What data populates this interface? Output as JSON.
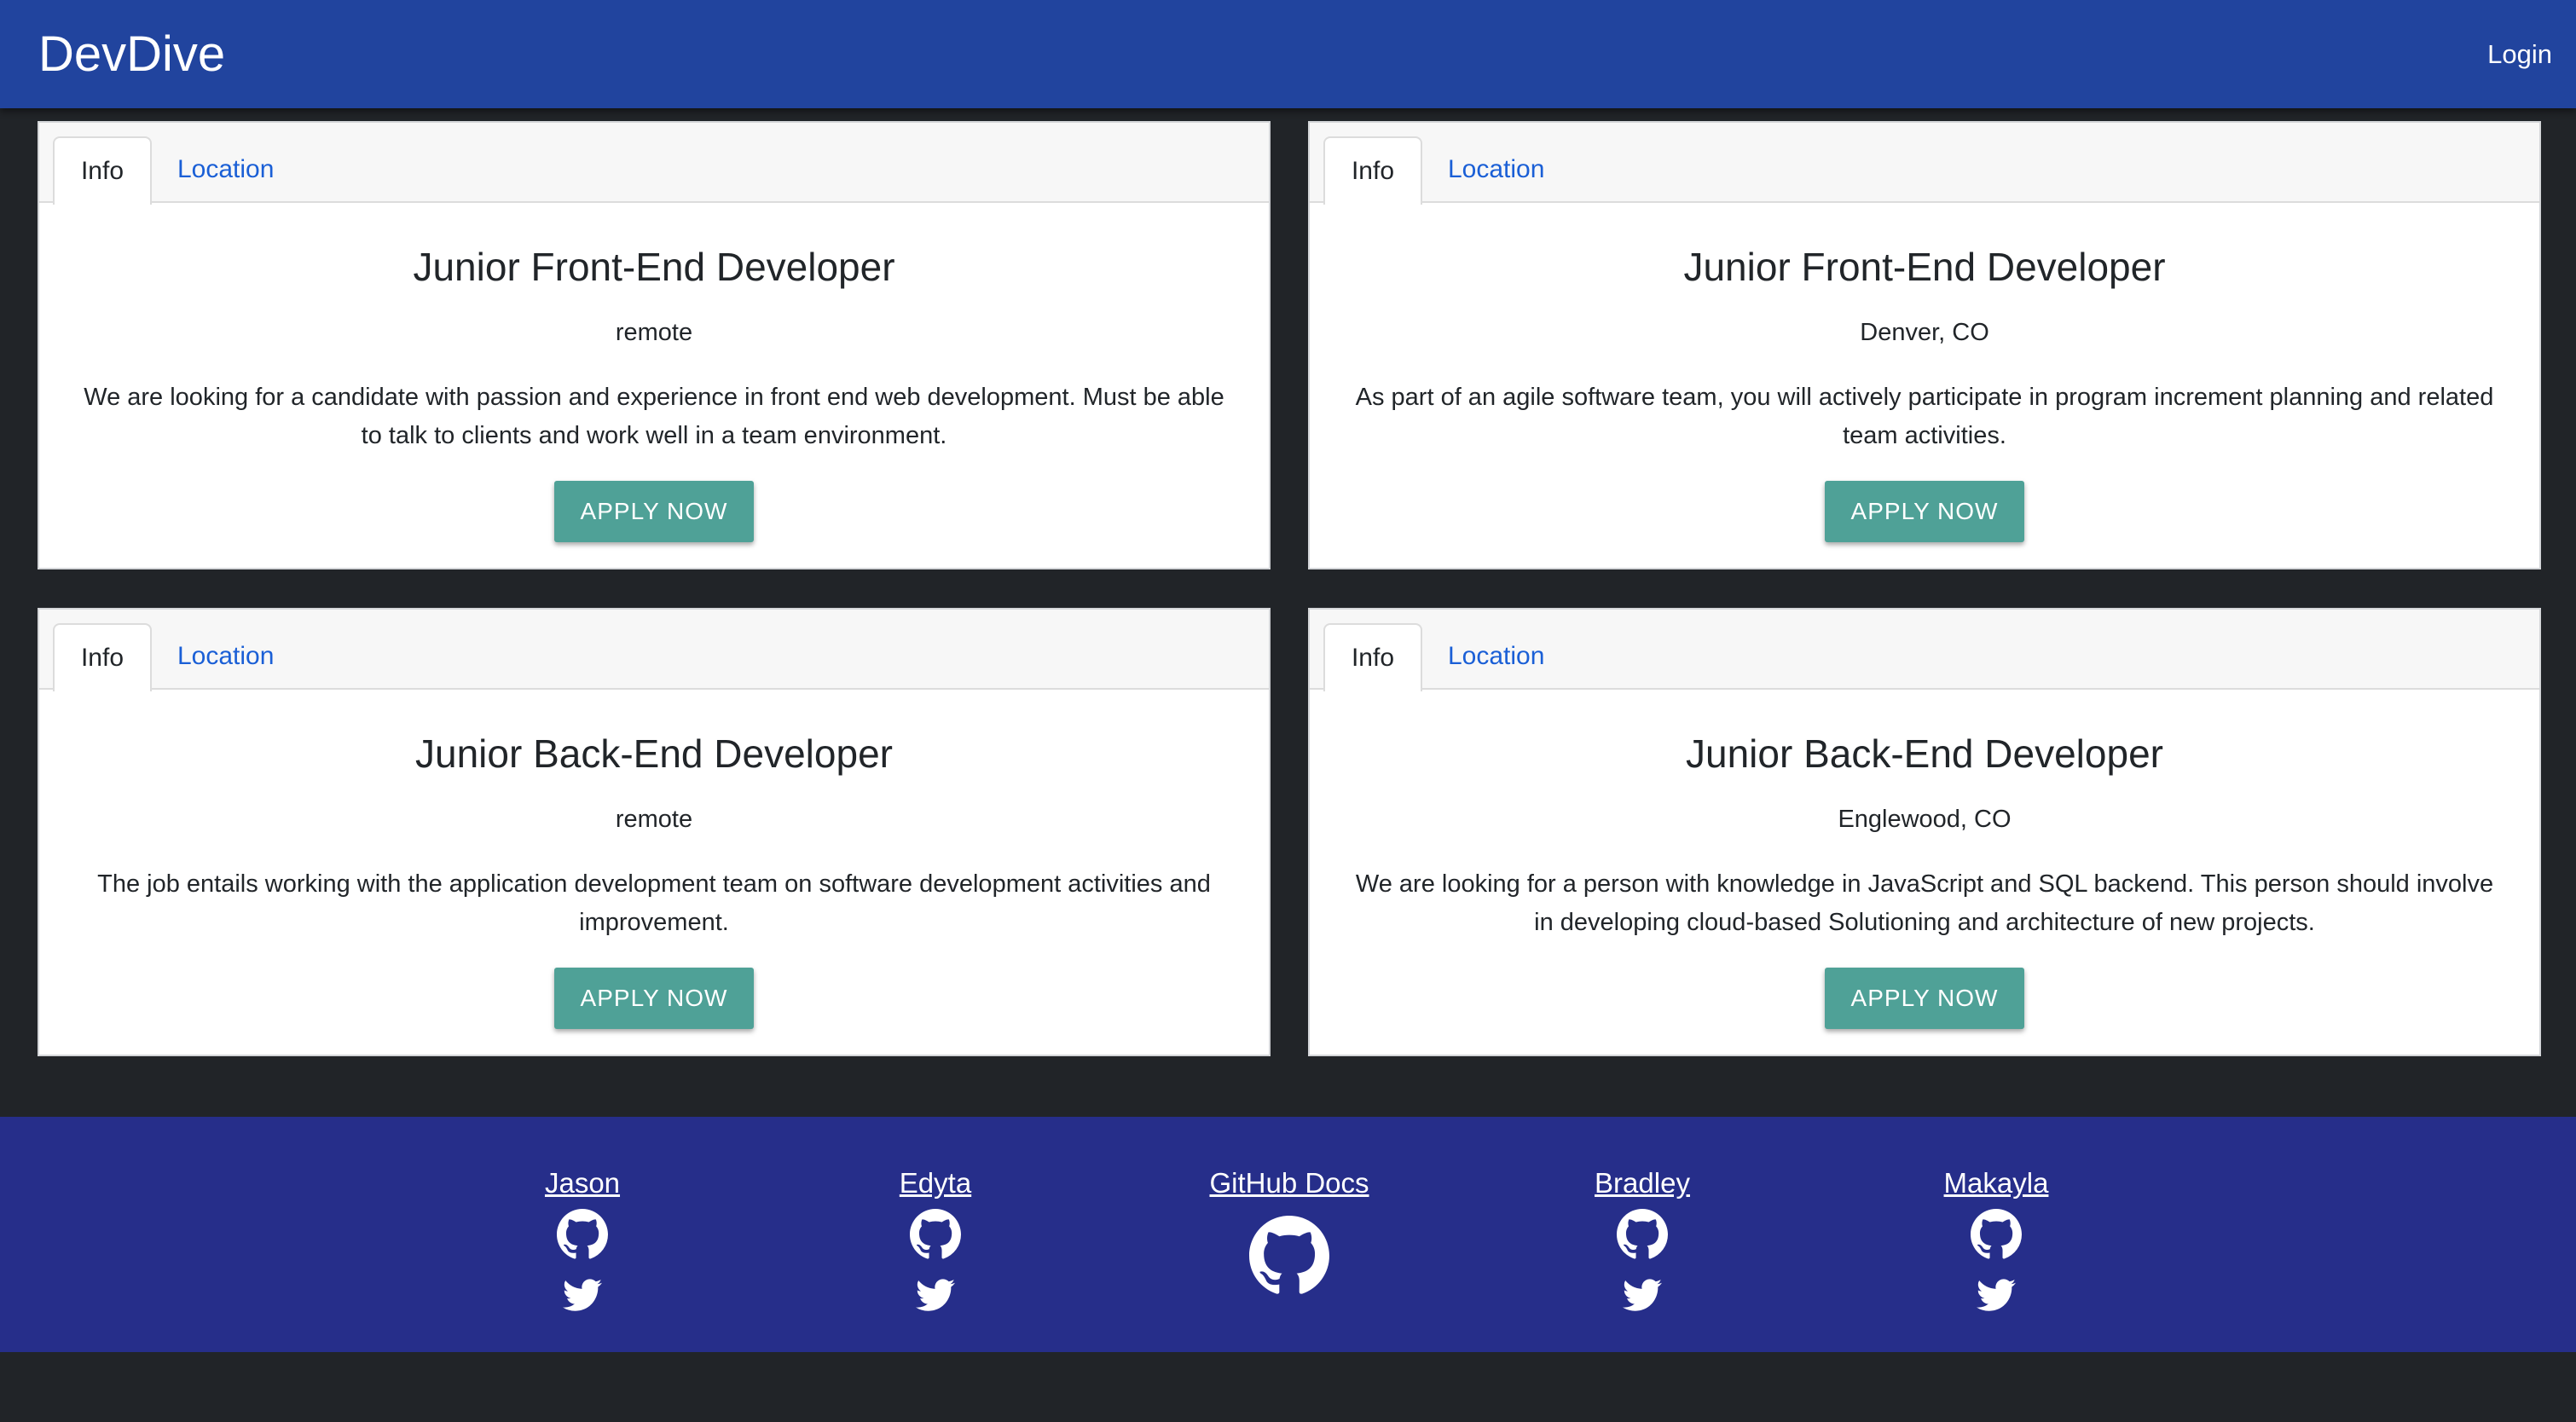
{
  "navbar": {
    "brand": "DevDive",
    "login_label": "Login"
  },
  "cards": [
    {
      "tabs": [
        "Info",
        "Location"
      ],
      "title": "Junior Front-End Developer",
      "location": "remote",
      "description": "We are looking for a candidate with passion and experience in front end web development. Must be able to talk to clients and work well in a team environment.",
      "button": "APPLY NOW"
    },
    {
      "tabs": [
        "Info",
        "Location"
      ],
      "title": "Junior Front-End Developer",
      "location": "Denver, CO",
      "description": "As part of an agile software team, you will actively participate in program increment planning and related team activities.",
      "button": "APPLY NOW"
    },
    {
      "tabs": [
        "Info",
        "Location"
      ],
      "title": "Junior Back-End Developer",
      "location": "remote",
      "description": "The job entails working with the application development team on software development activities and improvement.",
      "button": "APPLY NOW"
    },
    {
      "tabs": [
        "Info",
        "Location"
      ],
      "title": "Junior Back-End Developer",
      "location": "Englewood, CO",
      "description": "We are looking for a person with knowledge in JavaScript and SQL backend. This person should involve in developing cloud-based Solutioning and architecture of new projects.",
      "button": "APPLY NOW"
    }
  ],
  "footer": {
    "members": [
      {
        "name": "Jason",
        "icons": [
          "github-icon",
          "twitter-icon"
        ]
      },
      {
        "name": "Edyta",
        "icons": [
          "github-icon",
          "twitter-icon"
        ]
      },
      {
        "name": "GitHub Docs",
        "icons": [
          "github-icon"
        ]
      },
      {
        "name": "Bradley",
        "icons": [
          "github-icon",
          "twitter-icon"
        ]
      },
      {
        "name": "Makayla",
        "icons": [
          "github-icon",
          "twitter-icon"
        ]
      }
    ]
  },
  "colors": {
    "navbar": "#21449e",
    "footer": "#262e8a",
    "background": "#212428",
    "button": "#4fa197",
    "link": "#1a5fd6"
  }
}
